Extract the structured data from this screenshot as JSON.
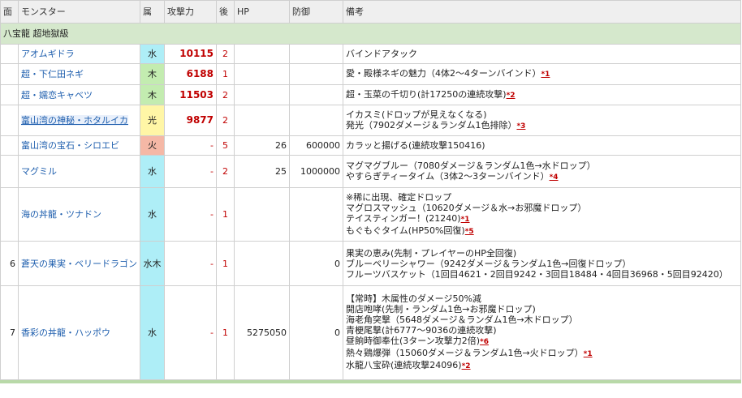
{
  "header": {
    "floor": "面",
    "monster": "モンスター",
    "attr": "属",
    "atk": "攻撃力",
    "turn": "後",
    "hp": "HP",
    "def": "防御",
    "notes": "備考"
  },
  "group_title": "八宝龍 超地獄級",
  "attr_colors": {
    "水": "#aeeef7",
    "木": "#c3ecb0",
    "光": "#fff6a6",
    "火": "#f5b8a6",
    "水木": "#aeeef7"
  },
  "rows": [
    {
      "floor": "",
      "name": "アオムギドラ",
      "attr": "水",
      "atk": "10115",
      "turn": "2",
      "hp": "",
      "def": "",
      "notes": [
        {
          "t": "バインドアタック",
          "r": ""
        }
      ]
    },
    {
      "floor": "",
      "name": "超・下仁田ネギ",
      "attr": "木",
      "atk": "6188",
      "turn": "1",
      "hp": "",
      "def": "",
      "notes": [
        {
          "t": "愛・殿様ネギの魅力（4体2〜4ターンバインド）",
          "r": "*1"
        }
      ]
    },
    {
      "floor": "",
      "name": "超・嬬恋キャベツ",
      "attr": "木",
      "atk": "11503",
      "turn": "2",
      "hp": "",
      "def": "",
      "notes": [
        {
          "t": "超・玉菜の千切り(計17250の連続攻撃)",
          "r": "*2"
        }
      ]
    },
    {
      "floor": "",
      "name": "富山湾の神秘・ホタルイカ",
      "attr": "光",
      "atk": "9877",
      "turn": "2",
      "hp": "",
      "def": "",
      "notes": [
        {
          "t": "イカスミ(ドロップが見えなくなる)",
          "r": ""
        },
        {
          "t": "発光（7902ダメージ＆ランダム1色排除）",
          "r": "*3"
        }
      ]
    },
    {
      "floor": "",
      "name": "富山湾の宝石・シロエビ",
      "attr": "火",
      "atk": "-",
      "turn": "5",
      "hp": "26",
      "def": "600000",
      "notes": [
        {
          "t": "カラッと揚げる(連続攻撃150416)",
          "r": ""
        }
      ]
    },
    {
      "floor": "",
      "name": "マグミル",
      "attr": "水",
      "atk": "-",
      "turn": "2",
      "hp": "25",
      "def": "1000000",
      "notes": [
        {
          "t": "マグマグブルー（7080ダメージ＆ランダム1色→水ドロップ）",
          "r": ""
        },
        {
          "t": "やすらぎティータイム（3体2〜3ターンバインド）",
          "r": "*4"
        }
      ]
    },
    {
      "floor": "",
      "name": "海の丼龍・ツナドン",
      "attr": "水",
      "atk": "-",
      "turn": "1",
      "hp": "",
      "def": "",
      "notes": [
        {
          "t": "※稀に出現、確定ドロップ",
          "r": ""
        },
        {
          "t": "マグロスマッシュ（10620ダメージ＆水→お邪魔ドロップ）",
          "r": ""
        },
        {
          "t": "テイスティンガー！(21240)",
          "r": "*1"
        },
        {
          "t": "もぐもぐタイム(HP50%回復)",
          "r": "*5"
        }
      ]
    },
    {
      "floor": "6",
      "name": "蒼天の果実・ベリードラゴン",
      "attr": "水木",
      "atk": "-",
      "turn": "1",
      "hp": "",
      "def": "0",
      "notes": [
        {
          "t": "果実の恵み(先制・プレイヤーのHP全回復)",
          "r": ""
        },
        {
          "t": "ブルーベリーシャワー（9242ダメージ＆ランダム1色→回復ドロップ）",
          "r": ""
        },
        {
          "t": "フルーツバスケット（1回目4621・2回目9242・3回目18484・4回目36968・5回目92420）",
          "r": ""
        }
      ]
    },
    {
      "floor": "7",
      "name": "香彩の丼龍・ハッポウ",
      "attr": "水",
      "atk": "-",
      "turn": "1",
      "hp": "5275050",
      "def": "0",
      "notes": [
        {
          "t": "【常時】木属性のダメージ50%減",
          "r": ""
        },
        {
          "t": "開店咆哮(先制・ランダム1色→お邪魔ドロップ)",
          "r": ""
        },
        {
          "t": "海老角突撃（5648ダメージ＆ランダム1色→木ドロップ）",
          "r": ""
        },
        {
          "t": "青梗尾撃(計6777〜9036の連続攻撃)",
          "r": ""
        },
        {
          "t": "昼餉時御奉仕(3ターン攻撃力2倍)",
          "r": "*6"
        },
        {
          "t": "熱々鶏爆弾（15060ダメージ＆ランダム1色→火ドロップ）",
          "r": "*1"
        },
        {
          "t": "水龍八宝砕(連続攻撃24096)",
          "r": "*2"
        }
      ]
    }
  ]
}
